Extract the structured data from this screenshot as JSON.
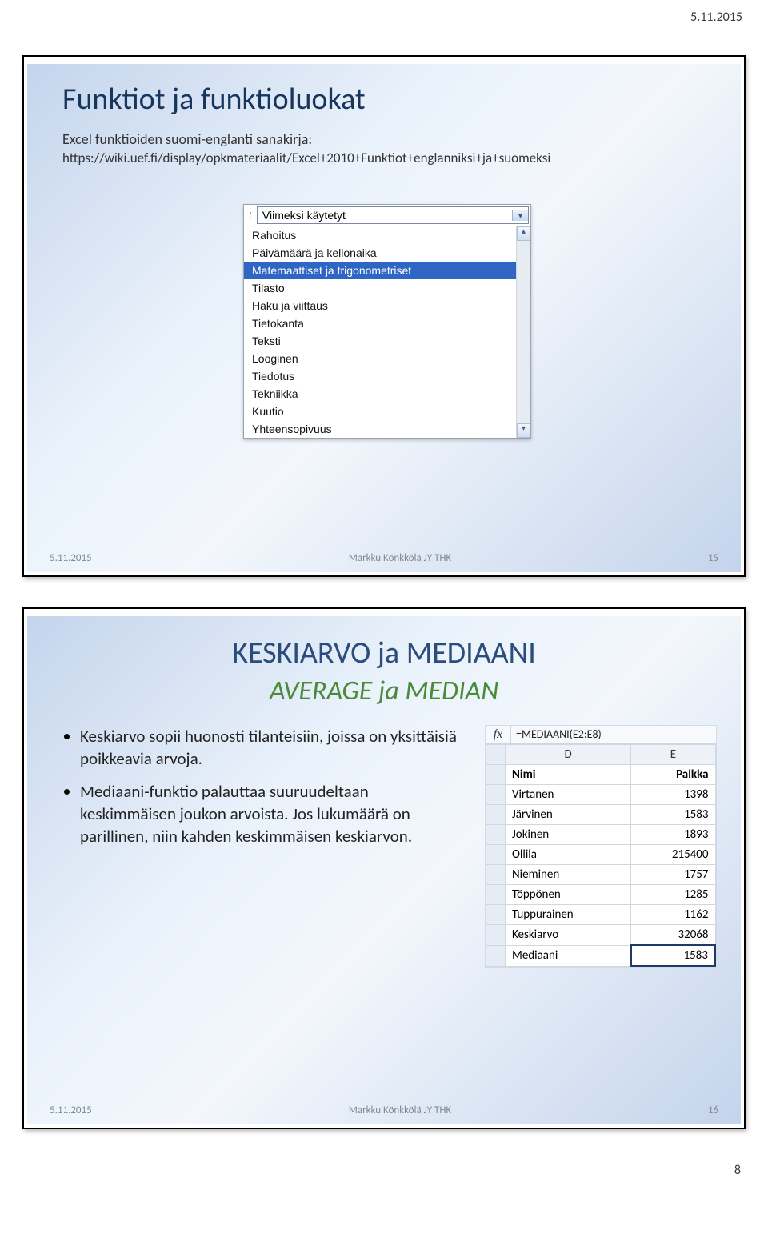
{
  "page": {
    "top_date": "5.11.2015",
    "page_number": "8"
  },
  "slide1": {
    "title": "Funktiot ja funktioluokat",
    "subtitle": "Excel funktioiden suomi-englanti sanakirja:",
    "link": "https://wiki.uef.fi/display/opkmateriaalit/Excel+2010+Funktiot+englanniksi+ja+suomeksi",
    "combo": {
      "label": ":",
      "selected_value": "Viimeksi käytetyt",
      "items": [
        {
          "label": "Rahoitus",
          "selected": false
        },
        {
          "label": "Päivämäärä ja kellonaika",
          "selected": false
        },
        {
          "label": "Matemaattiset ja trigonometriset",
          "selected": true
        },
        {
          "label": "Tilasto",
          "selected": false
        },
        {
          "label": "Haku ja viittaus",
          "selected": false
        },
        {
          "label": "Tietokanta",
          "selected": false
        },
        {
          "label": "Teksti",
          "selected": false
        },
        {
          "label": "Looginen",
          "selected": false
        },
        {
          "label": "Tiedotus",
          "selected": false
        },
        {
          "label": "Tekniikka",
          "selected": false
        },
        {
          "label": "Kuutio",
          "selected": false
        },
        {
          "label": "Yhteensopivuus",
          "selected": false
        }
      ]
    },
    "footer": {
      "date": "5.11.2015",
      "center": "Markku Könkkölä JY THK",
      "num": "15"
    }
  },
  "slide2": {
    "title_main": "KESKIARVO ja MEDIAANI",
    "title_sub": "AVERAGE ja MEDIAN",
    "bullets": [
      "Keskiarvo sopii huonosti tilanteisiin, joissa on yksittäisiä poikkeavia arvoja.",
      "Mediaani-funktio palauttaa suuruudeltaan keskimmäisen joukon arvoista. Jos lukumäärä on parillinen, niin kahden keskimmäisen keskiarvon."
    ],
    "fx_label": "fx",
    "formula": "=MEDIAANI(E2:E8)",
    "table": {
      "col_letters": [
        "D",
        "E"
      ],
      "headers": [
        "Nimi",
        "Palkka"
      ],
      "rows": [
        {
          "name": "Virtanen",
          "value": "1398"
        },
        {
          "name": "Järvinen",
          "value": "1583"
        },
        {
          "name": "Jokinen",
          "value": "1893"
        },
        {
          "name": "Ollila",
          "value": "215400"
        },
        {
          "name": "Nieminen",
          "value": "1757"
        },
        {
          "name": "Töppönen",
          "value": "1285"
        },
        {
          "name": "Tuppurainen",
          "value": "1162"
        },
        {
          "name": "Keskiarvo",
          "value": "32068"
        },
        {
          "name": "Mediaani",
          "value": "1583"
        }
      ]
    },
    "footer": {
      "date": "5.11.2015",
      "center": "Markku Könkkölä JY THK",
      "num": "16"
    }
  }
}
